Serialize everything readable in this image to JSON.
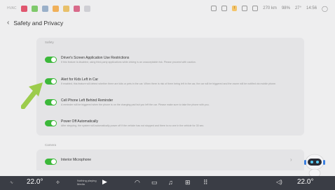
{
  "colors": {
    "toggle_on": "#3cb83a",
    "arrow": "#9ccc4c",
    "bottom_bar": "#3a3d45",
    "panel": "#e4e4e6",
    "background": "#eeeeef"
  },
  "status": {
    "left_text": "HVAC",
    "battery": "270 km",
    "battery_pct": "98%",
    "temp": "27°",
    "time": "14:56"
  },
  "header": {
    "title": "Safety and Privacy"
  },
  "section1": {
    "label": "Safety"
  },
  "settings": [
    {
      "title": "Driver's Screen Application Use Restrictions",
      "desc": "If this feature is disabled, using third-party applications while driving is an unacceptable risk. Please proceed with caution."
    },
    {
      "title": "Alert for Kids Left in Car",
      "desc": "If enabled, this feature will detect whether there are kids or pets in the car. When there is risk of them being left in the car, the car will be triggered and the owner will be notified via mobile phone."
    },
    {
      "title": "Cell Phone Left Behind Reminder",
      "desc": "A reminder will be triggered when the phone is on the charging pad but you left the car. Please make sure to take the phone with you."
    },
    {
      "title": "Power Off Automatically",
      "desc": "After stepping, the system will automatically power off if the vehicle has not stopped and there is no one in the vehicle for 30 sec."
    }
  ],
  "section2": {
    "label": "Camera",
    "item": {
      "title": "Interior Microphone"
    }
  },
  "bottom": {
    "temp_left": "22.0°",
    "temp_right": "22.0°",
    "media_line1": "Nothing playing",
    "media_line2": "Media",
    "play_icon": "play-icon"
  }
}
